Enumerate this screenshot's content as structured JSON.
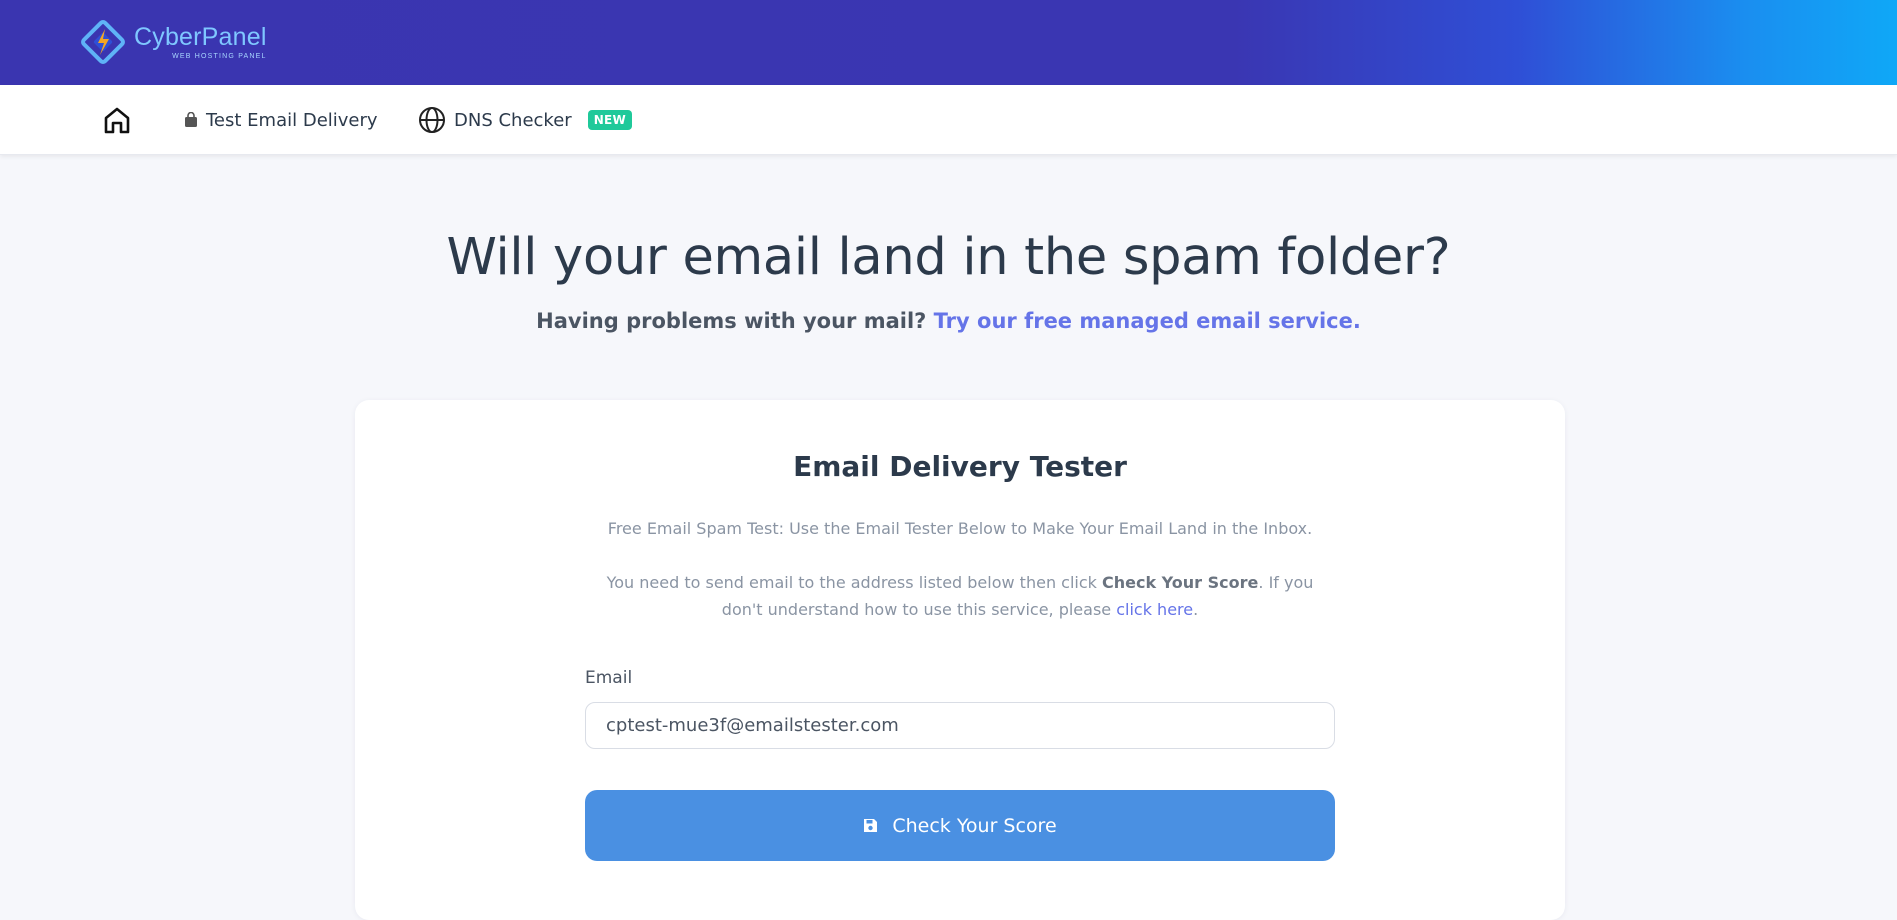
{
  "header": {
    "logo_text": "CyberPanel",
    "logo_subtext": "WEB HOSTING PANEL",
    "gradient_colors": [
      "#3a35b0",
      "#0fa8f7"
    ]
  },
  "nav": {
    "home_icon": "home-icon",
    "items": [
      {
        "label": "Test Email Delivery",
        "icon": "shopping-bag-icon"
      },
      {
        "label": "DNS Checker",
        "icon": "globe-icon",
        "badge": "NEW"
      }
    ],
    "badge_color": "#1fc99a"
  },
  "hero": {
    "title": "Will your email land in the spam folder?",
    "subtitle_text": "Having problems with your mail?",
    "subtitle_link": "Try our free managed email service."
  },
  "card": {
    "title": "Email Delivery Tester",
    "description1": "Free Email Spam Test: Use the Email Tester Below to Make Your Email Land in the Inbox.",
    "description2_pre": "You need to send email to the address listed below then click ",
    "description2_bold": "Check Your Score",
    "description2_mid": ". If you don't understand how to use this service, please ",
    "description2_link": "click here",
    "description2_post": ".",
    "email_label": "Email",
    "email_value": "cptest-mue3f@emailstester.com",
    "button_label": "Check Your Score",
    "button_icon": "save-icon",
    "button_color": "#4a90e2",
    "link_color": "#6574e8"
  }
}
